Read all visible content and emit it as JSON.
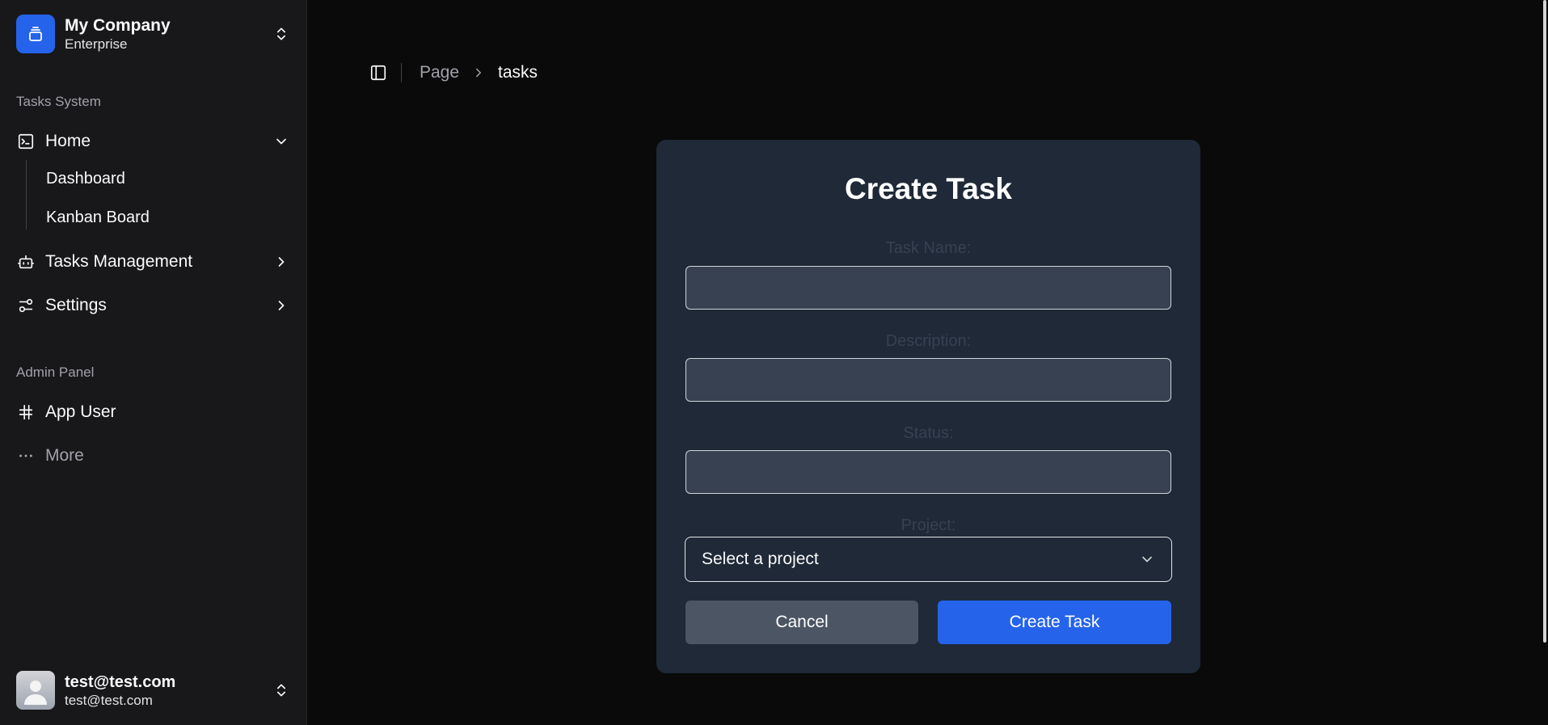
{
  "sidebar": {
    "company": {
      "name": "My Company",
      "plan": "Enterprise",
      "icon": "layers-icon"
    },
    "sections": [
      {
        "label": "Tasks System"
      },
      {
        "label": "Admin Panel"
      }
    ],
    "nav": {
      "home": {
        "label": "Home",
        "icon": "terminal-icon",
        "expanded": true
      },
      "dashboard": {
        "label": "Dashboard"
      },
      "kanban": {
        "label": "Kanban Board"
      },
      "tasks_management": {
        "label": "Tasks Management",
        "icon": "bot-icon"
      },
      "settings": {
        "label": "Settings",
        "icon": "sliders-icon"
      },
      "app_user": {
        "label": "App User",
        "icon": "hash-icon"
      },
      "more": {
        "label": "More",
        "icon": "more-horizontal-icon"
      }
    },
    "user": {
      "name": "test@test.com",
      "email": "test@test.com"
    }
  },
  "header": {
    "breadcrumb": {
      "parent": "Page",
      "current": "tasks"
    }
  },
  "form": {
    "title": "Create Task",
    "fields": {
      "task_name": {
        "label": "Task Name:",
        "value": ""
      },
      "description": {
        "label": "Description:",
        "value": ""
      },
      "status": {
        "label": "Status:",
        "value": ""
      },
      "project": {
        "label": "Project:",
        "selected": "Select a project"
      }
    },
    "buttons": {
      "cancel": "Cancel",
      "create": "Create Task"
    }
  },
  "colors": {
    "accent": "#2563eb",
    "card_bg": "#1f2937",
    "sidebar_bg": "#18181b",
    "main_bg": "#0a0a0a"
  }
}
